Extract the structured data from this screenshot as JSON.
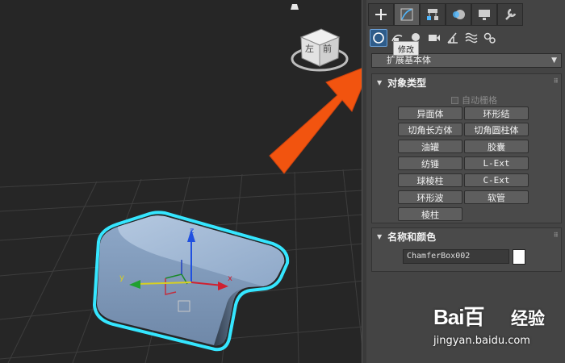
{
  "colors": {
    "panel_bg": "#444444",
    "viewport_bg": "#262626",
    "accent_blue": "#2e5c8a",
    "arrow_orange": "#f2540f",
    "selection_cyan": "#35e6ff",
    "object_fill": "#8aa6c8"
  },
  "viewcube": {
    "face_left": "左",
    "face_front": "前"
  },
  "command_panel": {
    "top_tabs": [
      {
        "name": "create",
        "icon": "plus-icon"
      },
      {
        "name": "modify",
        "icon": "modify-curve-icon"
      },
      {
        "name": "hierarchy",
        "icon": "hierarchy-icon"
      },
      {
        "name": "motion",
        "icon": "motion-icon"
      },
      {
        "name": "display",
        "icon": "display-monitor-icon"
      },
      {
        "name": "utilities",
        "icon": "wrench-icon"
      }
    ],
    "sub_tabs": [
      "geometry-icon",
      "shapes-icon",
      "lights-icon",
      "cameras-icon",
      "helpers-icon",
      "spacewarps-icon",
      "systems-icon"
    ],
    "tooltip": "修改",
    "dropdown": {
      "value": "扩展基本体"
    },
    "object_type": {
      "title": "对象类型",
      "autogrid": "自动栅格",
      "buttons": [
        "异面体",
        "环形结",
        "切角长方体",
        "切角圆柱体",
        "油罐",
        "胶囊",
        "纺锤",
        "L-Ext",
        "球棱柱",
        "C-Ext",
        "环形波",
        "软管",
        "棱柱"
      ]
    },
    "name_color": {
      "title": "名称和颜色",
      "name_value": "ChamferBox002",
      "swatch_color": "#ffffff"
    }
  },
  "gizmo": {
    "x": "x",
    "y": "y",
    "z": "z"
  },
  "watermark": {
    "logo": "Bai百",
    "cn": "经验",
    "url": "jingyan.baidu.com"
  }
}
